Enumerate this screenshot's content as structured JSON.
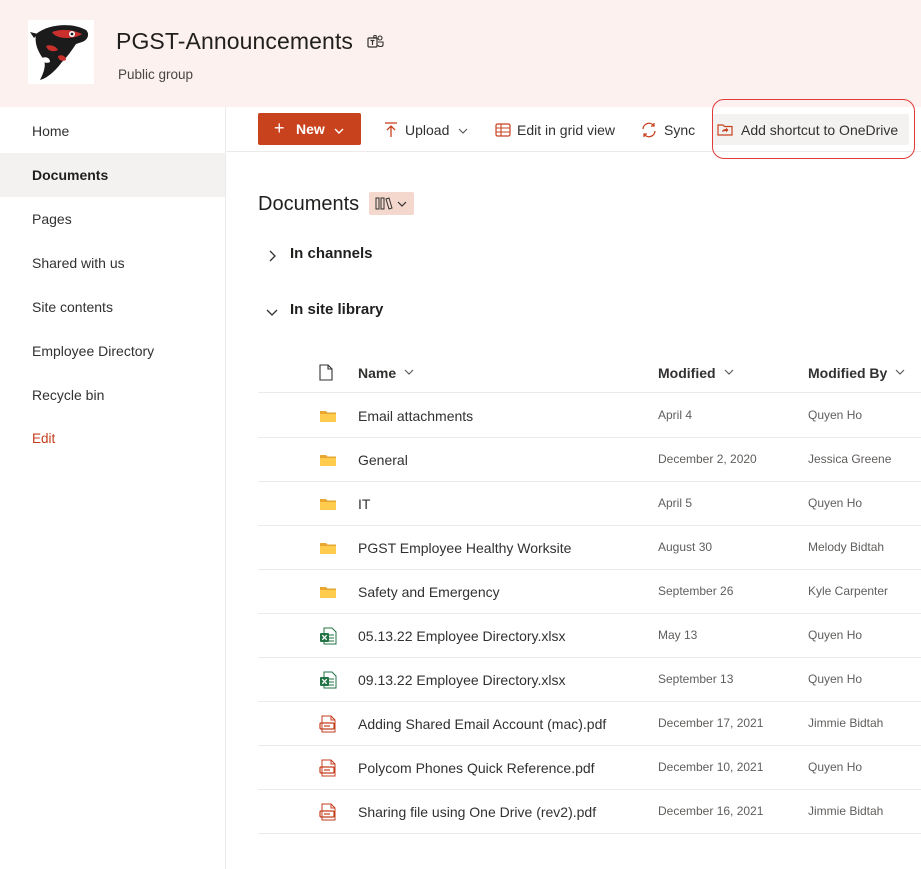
{
  "site": {
    "title": "PGST-Announcements",
    "subtitle": "Public group"
  },
  "nav": {
    "items": [
      {
        "label": "Home",
        "selected": false
      },
      {
        "label": "Documents",
        "selected": true
      },
      {
        "label": "Pages",
        "selected": false
      },
      {
        "label": "Shared with us",
        "selected": false
      },
      {
        "label": "Site contents",
        "selected": false
      },
      {
        "label": "Employee Directory",
        "selected": false
      },
      {
        "label": "Recycle bin",
        "selected": false
      }
    ],
    "edit_label": "Edit"
  },
  "commandbar": {
    "new_label": "New",
    "upload_label": "Upload",
    "grid_label": "Edit in grid view",
    "sync_label": "Sync",
    "shortcut_label": "Add shortcut to OneDrive"
  },
  "library": {
    "title": "Documents",
    "groups": {
      "channels": "In channels",
      "site": "In site library"
    },
    "columns": {
      "name": "Name",
      "modified": "Modified",
      "modified_by": "Modified By"
    },
    "files": [
      {
        "type": "folder",
        "name": "Email attachments",
        "modified": "April 4",
        "modified_by": "Quyen Ho"
      },
      {
        "type": "folder",
        "name": "General",
        "modified": "December 2, 2020",
        "modified_by": "Jessica Greene"
      },
      {
        "type": "folder",
        "name": "IT",
        "modified": "April 5",
        "modified_by": "Quyen Ho"
      },
      {
        "type": "folder",
        "name": "PGST Employee Healthy Worksite",
        "modified": "August 30",
        "modified_by": "Melody Bidtah"
      },
      {
        "type": "folder",
        "name": "Safety and Emergency",
        "modified": "September 26",
        "modified_by": "Kyle Carpenter"
      },
      {
        "type": "excel",
        "name": "05.13.22 Employee Directory.xlsx",
        "modified": "May 13",
        "modified_by": "Quyen Ho"
      },
      {
        "type": "excel",
        "name": "09.13.22 Employee Directory.xlsx",
        "modified": "September 13",
        "modified_by": "Quyen Ho"
      },
      {
        "type": "pdf",
        "name": "Adding Shared Email Account (mac).pdf",
        "modified": "December 17, 2021",
        "modified_by": "Jimmie Bidtah"
      },
      {
        "type": "pdf",
        "name": "Polycom Phones Quick Reference.pdf",
        "modified": "December 10, 2021",
        "modified_by": "Quyen Ho"
      },
      {
        "type": "pdf",
        "name": "Sharing file using One Drive (rev2).pdf",
        "modified": "December 16, 2021",
        "modified_by": "Jimmie Bidtah"
      }
    ]
  },
  "colors": {
    "accent": "#c8421e",
    "header_bg": "#fcf1ee",
    "highlight_ring": "#e03a3a",
    "folder": "#ffcc4d",
    "excel": "#217346",
    "pdf": "#c43e1c"
  }
}
